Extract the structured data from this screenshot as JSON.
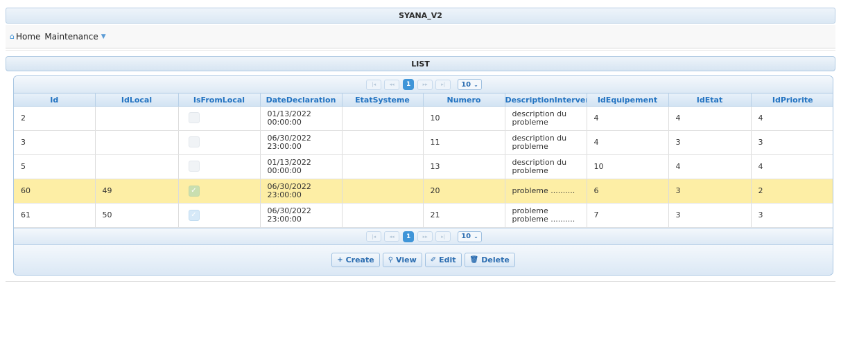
{
  "app": {
    "title": "SYANA_V2"
  },
  "menu": {
    "home_label": "Home",
    "maintenance_label": "Maintenance"
  },
  "panel": {
    "title": "LIST"
  },
  "paginator": {
    "first": "⏮",
    "prev": "◀◀",
    "current_page": "1",
    "next": "▶▶",
    "last": "⏭",
    "rows_per_page": "10"
  },
  "table": {
    "columns": [
      "Id",
      "IdLocal",
      "IsFromLocal",
      "DateDeclaration",
      "EtatSysteme",
      "Numero",
      "DescriptionInterven",
      "IdEquipement",
      "IdEtat",
      "IdPriorite"
    ],
    "rows": [
      {
        "id": "2",
        "idlocal": "",
        "isfromlocal": false,
        "date": "01/13/2022",
        "time": "00:00:00",
        "etat": "",
        "numero": "10",
        "desc1": "description du",
        "desc2": "probleme",
        "idequipement": "4",
        "idetat": "4",
        "idpriorite": "4",
        "selected": false
      },
      {
        "id": "3",
        "idlocal": "",
        "isfromlocal": false,
        "date": "06/30/2022",
        "time": "23:00:00",
        "etat": "",
        "numero": "11",
        "desc1": "description du",
        "desc2": "probleme",
        "idequipement": "4",
        "idetat": "3",
        "idpriorite": "3",
        "selected": false
      },
      {
        "id": "5",
        "idlocal": "",
        "isfromlocal": false,
        "date": "01/13/2022",
        "time": "00:00:00",
        "etat": "",
        "numero": "13",
        "desc1": "description du",
        "desc2": "probleme",
        "idequipement": "10",
        "idetat": "4",
        "idpriorite": "4",
        "selected": false
      },
      {
        "id": "60",
        "idlocal": "49",
        "isfromlocal": true,
        "date": "06/30/2022",
        "time": "23:00:00",
        "etat": "",
        "numero": "20",
        "desc1": "probleme ..........",
        "desc2": "",
        "idequipement": "6",
        "idetat": "3",
        "idpriorite": "2",
        "selected": true
      },
      {
        "id": "61",
        "idlocal": "50",
        "isfromlocal": true,
        "date": "06/30/2022",
        "time": "23:00:00",
        "etat": "",
        "numero": "21",
        "desc1": "probleme",
        "desc2": "probleme ..........",
        "idequipement": "7",
        "idetat": "3",
        "idpriorite": "3",
        "selected": false
      }
    ]
  },
  "actions": {
    "create": "Create",
    "view": "View",
    "edit": "Edit",
    "delete": "Delete"
  },
  "colors": {
    "accent": "#3f95d8",
    "header_text": "#2373c1",
    "selected_row": "#fdeea5"
  }
}
